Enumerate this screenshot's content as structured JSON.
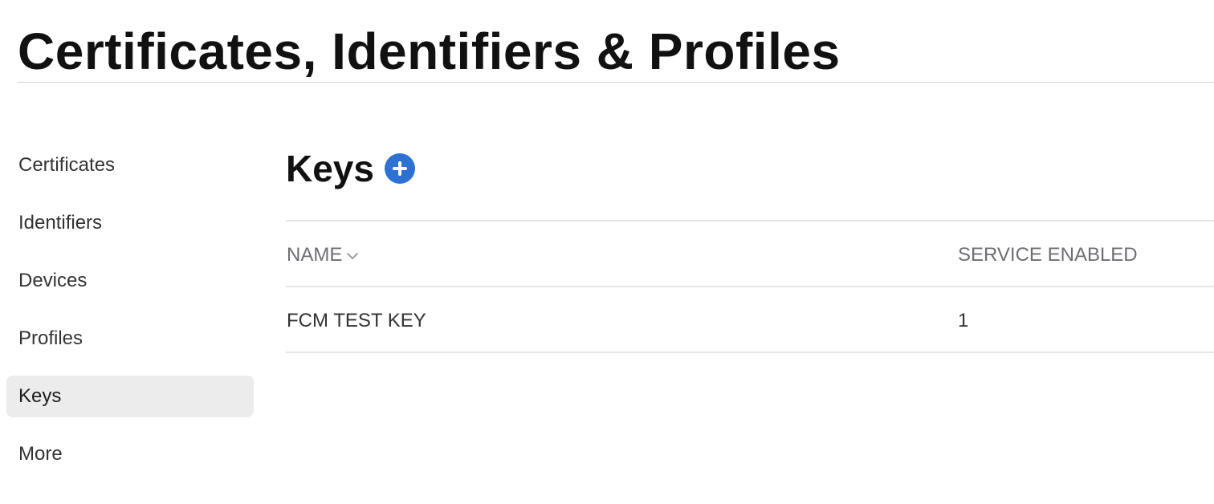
{
  "page": {
    "title": "Certificates, Identifiers & Profiles"
  },
  "sidebar": {
    "items": [
      {
        "label": "Certificates",
        "active": false
      },
      {
        "label": "Identifiers",
        "active": false
      },
      {
        "label": "Devices",
        "active": false
      },
      {
        "label": "Profiles",
        "active": false
      },
      {
        "label": "Keys",
        "active": true
      },
      {
        "label": "More",
        "active": false
      }
    ]
  },
  "main": {
    "section_title": "Keys",
    "add_icon": "plus-circle-icon",
    "accent_color": "#2d72d2",
    "table": {
      "columns": [
        {
          "label": "NAME",
          "sortable": true,
          "sort_icon": "chevron-down-icon"
        },
        {
          "label": "SERVICE ENABLED",
          "sortable": false
        }
      ],
      "rows": [
        {
          "name": "FCM TEST KEY",
          "service_enabled": "1"
        }
      ]
    }
  }
}
